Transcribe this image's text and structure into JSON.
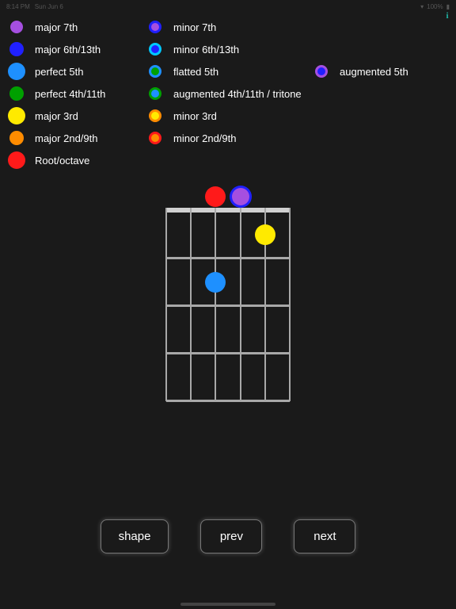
{
  "status": {
    "time": "8:14 PM",
    "date": "Sun Jun 6",
    "battery": "100%"
  },
  "info_button": "i",
  "legend": {
    "rows": [
      {
        "c1": {
          "label": "major 7th",
          "fill": "#a54fe0",
          "size": "small"
        },
        "c2": {
          "label": "minor 7th",
          "fill": "#a54fe0",
          "ring": "#2020ff"
        }
      },
      {
        "c1": {
          "label": "major 6th/13th",
          "fill": "#2020ff"
        },
        "c2": {
          "label": "minor 6th/13th",
          "fill": "#2020ff",
          "ring": "#00c8ff"
        }
      },
      {
        "c1": {
          "label": "perfect 5th",
          "fill": "#1e90ff",
          "size": "big"
        },
        "c2": {
          "label": "flatted 5th",
          "fill": "#00a000",
          "ring": "#1e90ff"
        },
        "c3": {
          "label": "augmented 5th",
          "fill": "#2020ff",
          "ring": "#a54fe0"
        }
      },
      {
        "c1": {
          "label": "perfect 4th/11th",
          "fill": "#00a000"
        },
        "c2": {
          "label": "augmented 4th/11th / tritone",
          "fill": "#1e90ff",
          "ring": "#00a000"
        }
      },
      {
        "c1": {
          "label": "major 3rd",
          "fill": "#ffea00",
          "size": "big"
        },
        "c2": {
          "label": "minor 3rd",
          "fill": "#ffea00",
          "ring": "#ff8c00"
        }
      },
      {
        "c1": {
          "label": "major 2nd/9th",
          "fill": "#ff8c00"
        },
        "c2": {
          "label": "minor 2nd/9th",
          "fill": "#ff8c00",
          "ring": "#ff1a1a"
        }
      },
      {
        "c1": {
          "label": "Root/octave",
          "fill": "#ff1a1a",
          "size": "big"
        }
      }
    ]
  },
  "fretboard": {
    "strings": 6,
    "frets": 4,
    "notes": [
      {
        "string": 2,
        "fret": 0,
        "fill": "#ff1a1a"
      },
      {
        "string": 3,
        "fret": 0,
        "fill": "#a54fe0",
        "ring": "#2020ff"
      },
      {
        "string": 4,
        "fret": 1,
        "fill": "#ffea00"
      },
      {
        "string": 2,
        "fret": 2,
        "fill": "#1e90ff"
      }
    ]
  },
  "buttons": {
    "shape": "shape",
    "prev": "prev",
    "next": "next"
  },
  "chart_data": {
    "type": "table",
    "title": "Guitar chord interval diagram",
    "legend_intervals": [
      {
        "interval": "major 7th",
        "color": "#a54fe0"
      },
      {
        "interval": "minor 7th",
        "color": "#a54fe0/#2020ff"
      },
      {
        "interval": "major 6th/13th",
        "color": "#2020ff"
      },
      {
        "interval": "minor 6th/13th",
        "color": "#2020ff/#00c8ff"
      },
      {
        "interval": "perfect 5th",
        "color": "#1e90ff"
      },
      {
        "interval": "flatted 5th",
        "color": "#00a000/#1e90ff"
      },
      {
        "interval": "augmented 5th",
        "color": "#2020ff/#a54fe0"
      },
      {
        "interval": "perfect 4th/11th",
        "color": "#00a000"
      },
      {
        "interval": "augmented 4th/11th / tritone",
        "color": "#1e90ff/#00a000"
      },
      {
        "interval": "major 3rd",
        "color": "#ffea00"
      },
      {
        "interval": "minor 3rd",
        "color": "#ffea00/#ff8c00"
      },
      {
        "interval": "major 2nd/9th",
        "color": "#ff8c00"
      },
      {
        "interval": "minor 2nd/9th",
        "color": "#ff8c00/#ff1a1a"
      },
      {
        "interval": "Root/octave",
        "color": "#ff1a1a"
      }
    ],
    "chord_notes": [
      {
        "string": 2,
        "fret": 0,
        "interval": "Root/octave"
      },
      {
        "string": 3,
        "fret": 0,
        "interval": "minor 7th"
      },
      {
        "string": 4,
        "fret": 1,
        "interval": "major 3rd"
      },
      {
        "string": 2,
        "fret": 2,
        "interval": "perfect 5th"
      }
    ]
  }
}
